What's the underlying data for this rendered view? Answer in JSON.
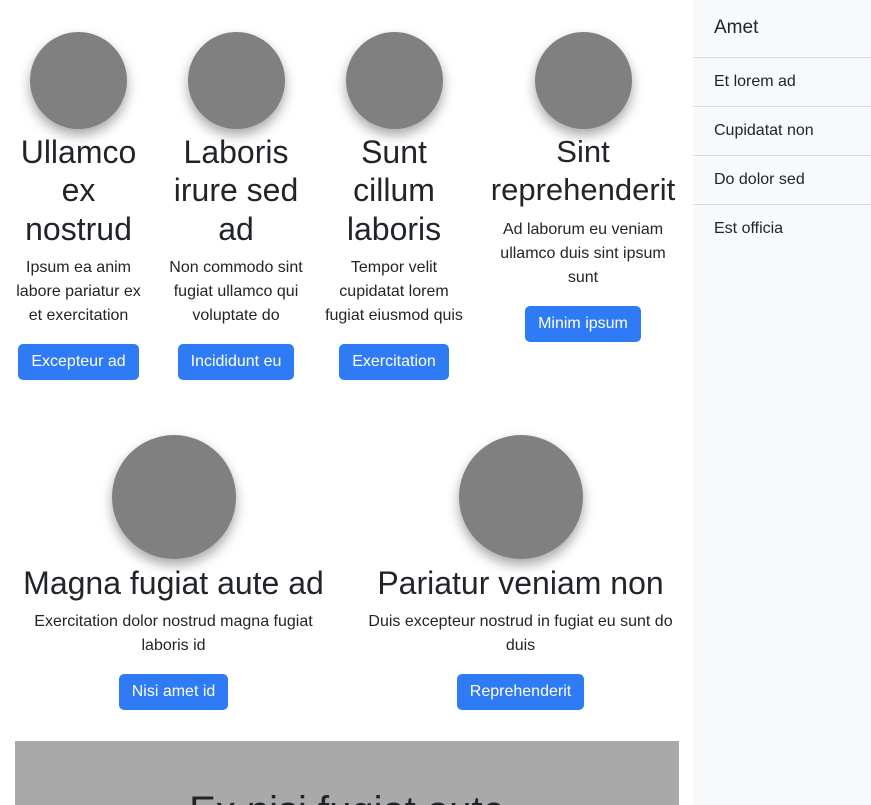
{
  "cards_top": [
    {
      "title": "Ullamco ex nostrud",
      "text": "Ipsum ea anim labore pariatur ex et exercitation",
      "button": "Excepteur ad"
    },
    {
      "title": "Laboris irure sed ad",
      "text": "Non commodo sint fugiat ullamco qui voluptate do",
      "button": "Incididunt eu"
    },
    {
      "title": "Sunt cillum laboris",
      "text": "Tempor velit cupidatat lorem fugiat eiusmod quis",
      "button": "Exercitation"
    },
    {
      "title": "Sint reprehenderit",
      "text": "Ad laborum eu veniam ullamco duis sint ipsum sunt",
      "button": "Minim ipsum"
    }
  ],
  "cards_bottom": [
    {
      "title": "Magna fugiat aute ad",
      "text": "Exercitation dolor nostrud magna fugiat laboris id",
      "button": "Nisi amet id"
    },
    {
      "title": "Pariatur veniam non",
      "text": "Duis excepteur nostrud in fugiat eu sunt do duis",
      "button": "Reprehenderit"
    }
  ],
  "banner": {
    "title": "Ex nisi fugiat aute"
  },
  "sidebar": {
    "title": "Amet",
    "items": [
      {
        "label": "Et lorem ad"
      },
      {
        "label": "Cupidatat non"
      },
      {
        "label": "Do dolor sed"
      },
      {
        "label": "Est officia"
      }
    ]
  }
}
